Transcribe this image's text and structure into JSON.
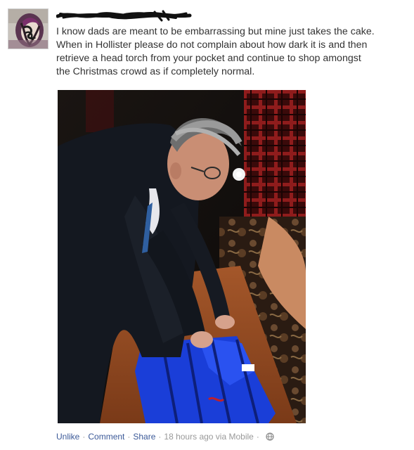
{
  "post": {
    "text_lines": [
      "I know dads are meant to be embarrassing but mine just takes the cake.",
      "When in Hollister please do not complain about how dark it is and then",
      "retrieve a head torch from your pocket and continue to shop amongst",
      "the Christmas crowd as if completely normal."
    ]
  },
  "footer": {
    "unlike_label": "Unlike",
    "comment_label": "Comment",
    "share_label": "Share",
    "separator": "·",
    "timestamp": "18 hours ago via Mobile",
    "audience_icon": "globe-icon"
  },
  "colors": {
    "link": "#3b5998",
    "meta": "#999999",
    "text": "#333333"
  }
}
